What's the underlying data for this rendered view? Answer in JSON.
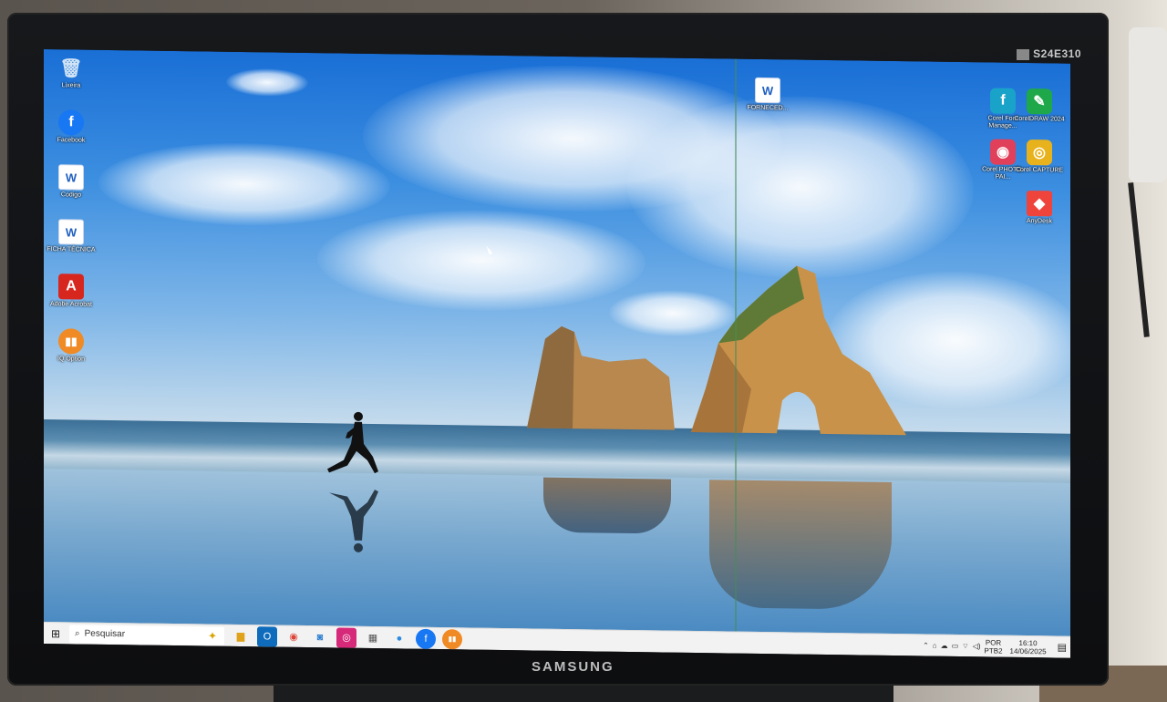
{
  "monitor": {
    "model": "S24E310",
    "brand": "SAMSUNG"
  },
  "desktop_icons_left": [
    {
      "label": "Lixeira",
      "icon": "recycle-bin-icon"
    },
    {
      "label": "Facebook",
      "icon": "facebook-icon"
    },
    {
      "label": "Codigo",
      "icon": "word-doc-icon"
    },
    {
      "label": "FICHA TÉCNICA",
      "icon": "word-doc-icon"
    },
    {
      "label": "Adobe Acrobat",
      "icon": "adobe-acrobat-icon"
    },
    {
      "label": "IQ Option",
      "icon": "iq-option-icon"
    }
  ],
  "desktop_icons_right": [
    {
      "label": "FORNECED...",
      "icon": "word-doc-icon"
    },
    {
      "label": "Corel Font Manage...",
      "icon": "corel-font-manager-icon"
    },
    {
      "label": "CorelDRAW 2024",
      "icon": "coreldraw-icon"
    },
    {
      "label": "Corel PHOTO-PAI...",
      "icon": "corel-photo-paint-icon"
    },
    {
      "label": "Corel CAPTURE",
      "icon": "corel-capture-icon"
    },
    {
      "label": "AnyDesk",
      "icon": "anydesk-icon"
    }
  ],
  "taskbar": {
    "search_placeholder": "Pesquisar",
    "pinned": [
      {
        "name": "file-explorer",
        "icon": "folder-icon"
      },
      {
        "name": "outlook",
        "icon": "outlook-icon"
      },
      {
        "name": "chrome",
        "icon": "chrome-icon"
      },
      {
        "name": "photos",
        "icon": "photos-icon"
      },
      {
        "name": "instagram",
        "icon": "instagram-icon"
      },
      {
        "name": "calculator",
        "icon": "calculator-icon"
      },
      {
        "name": "copilot",
        "icon": "copilot-icon"
      },
      {
        "name": "facebook",
        "icon": "facebook-icon"
      },
      {
        "name": "iq-option",
        "icon": "iq-option-icon"
      }
    ],
    "lang_top": "POR",
    "lang_bottom": "PTB2",
    "time": "16:10",
    "date": "14/06/2025"
  },
  "colors": {
    "facebook": "#1877f2",
    "acrobat": "#d7261e",
    "iq_option": "#f08a24",
    "corel_green": "#1fa84a",
    "anydesk": "#ef443b"
  }
}
